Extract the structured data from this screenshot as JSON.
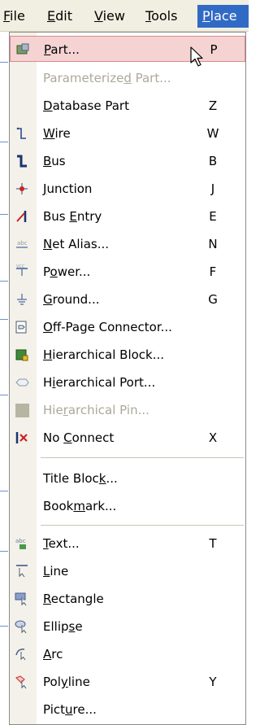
{
  "menubar": {
    "file": {
      "pre": "",
      "acc": "F",
      "post": "ile"
    },
    "edit": {
      "pre": "",
      "acc": "E",
      "post": "dit"
    },
    "view": {
      "pre": "",
      "acc": "V",
      "post": "iew"
    },
    "tools": {
      "pre": "",
      "acc": "T",
      "post": "ools"
    },
    "place": {
      "pre": "",
      "acc": "P",
      "post": "lace"
    }
  },
  "colors": {
    "menu_active": "#316ac5",
    "item_hover_bg": "#f5d3d3",
    "disabled_text": "#aca899"
  },
  "menu": {
    "part": {
      "pre": "",
      "acc": "P",
      "post": "art...",
      "shortcut": "P",
      "icon": "part-icon"
    },
    "parameterized_part": {
      "pre": "Parameterize",
      "acc": "d",
      "post": " Part...",
      "shortcut": "",
      "icon": ""
    },
    "database_part": {
      "pre": "",
      "acc": "D",
      "post": "atabase Part",
      "shortcut": "Z",
      "icon": ""
    },
    "wire": {
      "pre": "",
      "acc": "W",
      "post": "ire",
      "shortcut": "W",
      "icon": "wire-icon"
    },
    "bus": {
      "pre": "",
      "acc": "B",
      "post": "us",
      "shortcut": "B",
      "icon": "bus-icon"
    },
    "junction": {
      "pre": "",
      "acc": "J",
      "post": "unction",
      "shortcut": "J",
      "icon": "junction-icon"
    },
    "bus_entry": {
      "pre": "Bus ",
      "acc": "E",
      "post": "ntry",
      "shortcut": "E",
      "icon": "bus-entry-icon"
    },
    "net_alias": {
      "pre": "",
      "acc": "N",
      "post": "et Alias...",
      "shortcut": "N",
      "icon": "net-alias-icon"
    },
    "power": {
      "pre": "P",
      "acc": "o",
      "post": "wer...",
      "shortcut": "F",
      "icon": "power-icon"
    },
    "ground": {
      "pre": "",
      "acc": "G",
      "post": "round...",
      "shortcut": "G",
      "icon": "ground-icon"
    },
    "off_page": {
      "pre": "",
      "acc": "O",
      "post": "ff-Page Connector...",
      "shortcut": "",
      "icon": "off-page-connector-icon"
    },
    "hier_block": {
      "pre": "",
      "acc": "H",
      "post": "ierarchical Block...",
      "shortcut": "",
      "icon": "hierarchical-block-icon"
    },
    "hier_port": {
      "pre": "H",
      "acc": "i",
      "post": "erarchical Port...",
      "shortcut": "",
      "icon": "hierarchical-port-icon"
    },
    "hier_pin": {
      "pre": "Hie",
      "acc": "r",
      "post": "archical Pin...",
      "shortcut": "",
      "icon": "hierarchical-pin-icon"
    },
    "no_connect": {
      "pre": "No ",
      "acc": "C",
      "post": "onnect",
      "shortcut": "X",
      "icon": "no-connect-icon"
    },
    "title_block": {
      "pre": "Title Bloc",
      "acc": "k",
      "post": "...",
      "shortcut": "",
      "icon": ""
    },
    "bookmark": {
      "pre": "Book",
      "acc": "m",
      "post": "ark...",
      "shortcut": "",
      "icon": ""
    },
    "text": {
      "pre": "",
      "acc": "T",
      "post": "ext...",
      "shortcut": "T",
      "icon": "text-icon"
    },
    "line": {
      "pre": "",
      "acc": "L",
      "post": "ine",
      "shortcut": "",
      "icon": "line-icon"
    },
    "rectangle": {
      "pre": "",
      "acc": "R",
      "post": "ectangle",
      "shortcut": "",
      "icon": "rectangle-icon"
    },
    "ellipse": {
      "pre": "Ellip",
      "acc": "s",
      "post": "e",
      "shortcut": "",
      "icon": "ellipse-icon"
    },
    "arc": {
      "pre": "",
      "acc": "A",
      "post": "rc",
      "shortcut": "",
      "icon": "arc-icon"
    },
    "polyline": {
      "pre": "Pol",
      "acc": "y",
      "post": "line",
      "shortcut": "Y",
      "icon": "polyline-icon"
    },
    "picture": {
      "pre": "Pict",
      "acc": "u",
      "post": "re...",
      "shortcut": "",
      "icon": ""
    }
  }
}
